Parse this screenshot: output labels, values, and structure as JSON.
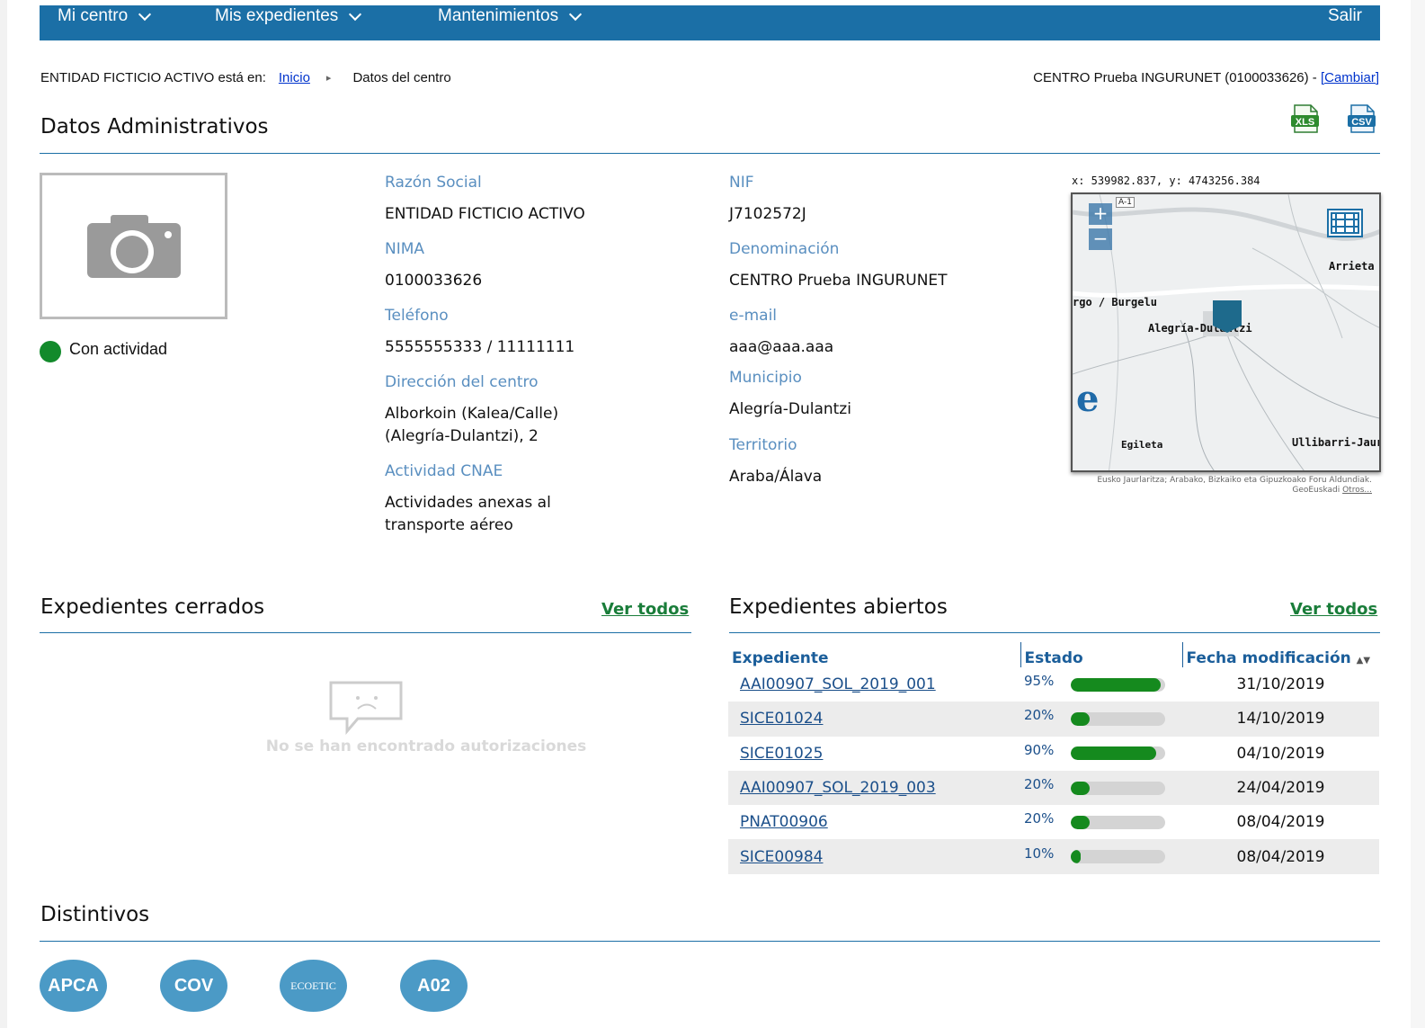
{
  "nav": {
    "items": [
      "Mi centro",
      "Mis expedientes",
      "Mantenimientos"
    ],
    "salir": "Salir"
  },
  "breadcrumb": {
    "prefix": "ENTIDAD FICTICIO ACTIVO está en:",
    "home": "Inicio",
    "current": "Datos del centro"
  },
  "center": {
    "text": "CENTRO Prueba INGURUNET (0100033626) - ",
    "change": "[Cambiar]"
  },
  "admin": {
    "title": "Datos Administrativos",
    "status": "Con actividad",
    "status_color": "#128a2b",
    "fields": {
      "razon_social_label": "Razón Social",
      "razon_social": "ENTIDAD FICTICIO ACTIVO",
      "nima_label": "NIMA",
      "nima": "0100033626",
      "telefono_label": "Teléfono",
      "telefono": "5555555333 / 11111111",
      "direccion_label": "Dirección del centro",
      "direccion_1": "Alborkoin (Kalea/Calle)",
      "direccion_2": "(Alegría-Dulantzi), 2",
      "cnae_label": "Actividad CNAE",
      "cnae_1": "Actividades anexas al",
      "cnae_2": "transporte aéreo",
      "nif_label": "NIF",
      "nif": "J7102572J",
      "denominacion_label": "Denominación",
      "denominacion": "CENTRO Prueba INGURUNET",
      "email_label": "e-mail",
      "email": "aaa@aaa.aaa",
      "municipio_label": "Municipio",
      "municipio": "Alegría-Dulantzi",
      "territorio_label": "Territorio",
      "territorio": "Araba/Álava"
    },
    "exports": [
      "XLS",
      "CSV"
    ]
  },
  "map": {
    "coords": "x: 539982.837, y: 4743256.384",
    "zoom_in": "+",
    "zoom_out": "−",
    "road": "A-1",
    "labels": {
      "arrieta": "Arrieta",
      "burgelu": "rgo / Burgelu",
      "alegria": "Alegría-Dulantzi",
      "egileta": "Egileta",
      "ullibarri": "Ullibarri-Jaur"
    },
    "logo": "e",
    "attribution": "Eusko Jaurlaritza; Arabako, Bizkaiko eta Gipuzkoako Foru Aldundiak. GeoEuskadi ",
    "attribution_link": "Otros..."
  },
  "closed": {
    "title": "Expedientes cerrados",
    "ver_todos": "Ver todos",
    "empty": "No se han encontrado autorizaciones"
  },
  "open": {
    "title": "Expedientes abiertos",
    "ver_todos": "Ver todos",
    "columns": [
      "Expediente",
      "Estado",
      "Fecha modificación"
    ],
    "rows": [
      {
        "expediente": "AAI00907_SOL_2019_001",
        "progress": 95,
        "pct": "95%",
        "fecha": "31/10/2019"
      },
      {
        "expediente": "SICE01024",
        "progress": 20,
        "pct": "20%",
        "fecha": "14/10/2019"
      },
      {
        "expediente": "SICE01025",
        "progress": 90,
        "pct": "90%",
        "fecha": "04/10/2019"
      },
      {
        "expediente": "AAI00907_SOL_2019_003",
        "progress": 20,
        "pct": "20%",
        "fecha": "24/04/2019"
      },
      {
        "expediente": "PNAT00906",
        "progress": 20,
        "pct": "20%",
        "fecha": "08/04/2019"
      },
      {
        "expediente": "SICE00984",
        "progress": 10,
        "pct": "10%",
        "fecha": "08/04/2019"
      }
    ]
  },
  "distintivos": {
    "title": "Distintivos",
    "badges": [
      "APCA",
      "COV",
      "ECOETIC",
      "A02"
    ]
  }
}
